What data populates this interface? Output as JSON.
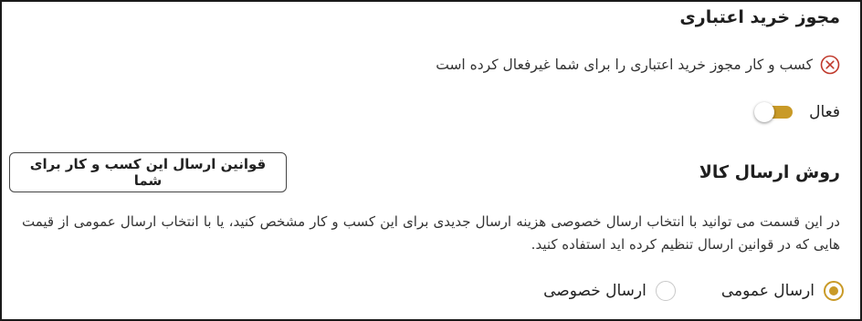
{
  "credit_section": {
    "title": "مجوز خرید اعتباری",
    "error_message": "کسب و کار مجوز خرید اعتباری را برای شما غیرفعال کرده است",
    "error_icon": "circle-x-icon",
    "toggle_label": "فعال",
    "toggle_on": true
  },
  "shipping_section": {
    "title": "روش ارسال کالا",
    "rules_button_label": "قوانین ارسال این کسب و کار برای شما",
    "description": "در این قسمت می توانید با انتخاب ارسال خصوصی هزینه ارسال جدیدی برای این کسب و کار مشخص کنید، یا با انتخاب ارسال عمومی از قیمت هایی که در قوانین ارسال تنظیم کرده اید استفاده کنید.",
    "options": [
      {
        "label": "ارسال عمومی",
        "selected": true
      },
      {
        "label": "ارسال خصوصی",
        "selected": false
      }
    ]
  },
  "colors": {
    "accent": "#c99a27",
    "error": "#c0392b",
    "border": "#1a1a1a"
  }
}
